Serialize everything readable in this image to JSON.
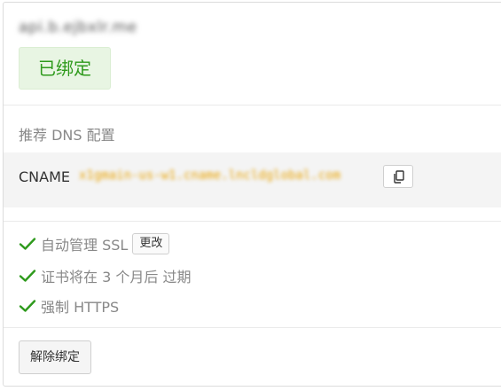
{
  "domain": {
    "name": "api.b.ejbxlr.me",
    "status_label": "已绑定"
  },
  "dns": {
    "section_title": "推荐 DNS 配置",
    "record_type": "CNAME",
    "record_value": "x1gmain-us-w1.cname.lncldglobal.com",
    "copy_icon": "copy-icon"
  },
  "features": {
    "auto_ssl_label": "自动管理 SSL",
    "change_button_label": "更改",
    "cert_expiry_label": "证书将在 3 个月后 过期",
    "https_label": "强制 HTTPS",
    "check_icon": "check-icon",
    "check_color": "#2e9a1c"
  },
  "actions": {
    "unbind_label": "解除绑定"
  }
}
